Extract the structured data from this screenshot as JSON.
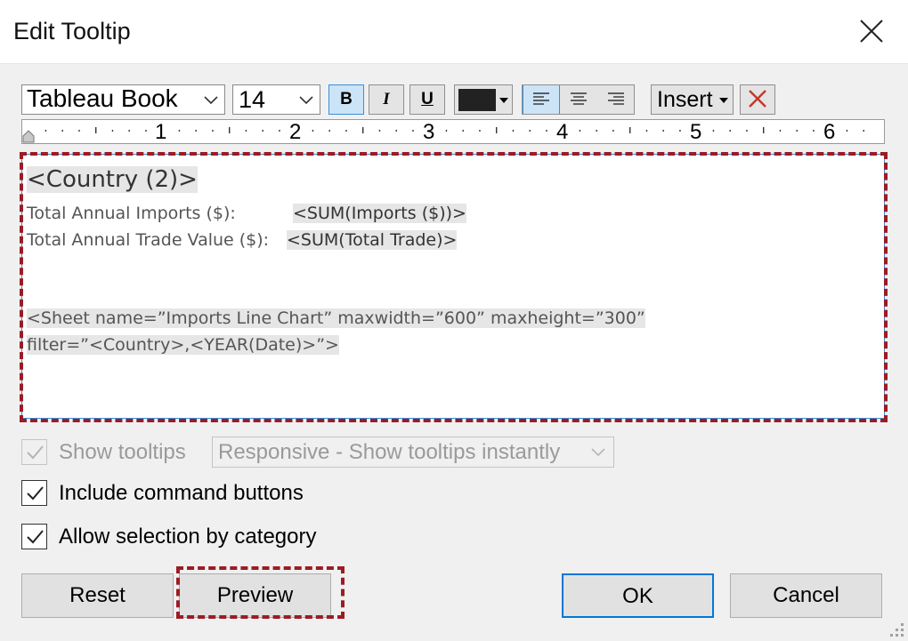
{
  "dialog": {
    "title": "Edit Tooltip"
  },
  "toolbar": {
    "font": "Tableau Book",
    "size": "14",
    "bold_label": "B",
    "italic_label": "I",
    "underline_label": "U",
    "text_color": "#222222",
    "insert_label": "Insert"
  },
  "ruler": {
    "marks": [
      "1",
      "2",
      "3",
      "4",
      "5",
      "6"
    ]
  },
  "editor": {
    "heading": "<Country (2)>",
    "imports_label": "Total Annual Imports ($):",
    "imports_value": "<SUM(Imports ($))>",
    "trade_label": "Total Annual Trade Value ($):",
    "trade_value": "<SUM(Total Trade)>",
    "sheet_line1": "<Sheet name=”Imports Line Chart” maxwidth=”600” maxheight=”300”",
    "sheet_line2": "filter=”<Country>,<YEAR(Date)>”>"
  },
  "options": {
    "show_tooltips_label": "Show tooltips",
    "show_tooltips_checked": true,
    "mode_value": "Responsive - Show tooltips instantly",
    "command_buttons_label": "Include command buttons",
    "command_buttons_checked": true,
    "selection_label": "Allow selection by category",
    "selection_checked": true
  },
  "buttons": {
    "reset": "Reset",
    "preview": "Preview",
    "ok": "OK",
    "cancel": "Cancel"
  },
  "colors": {
    "highlight": "#9b1c24",
    "accent": "#0078d7"
  }
}
